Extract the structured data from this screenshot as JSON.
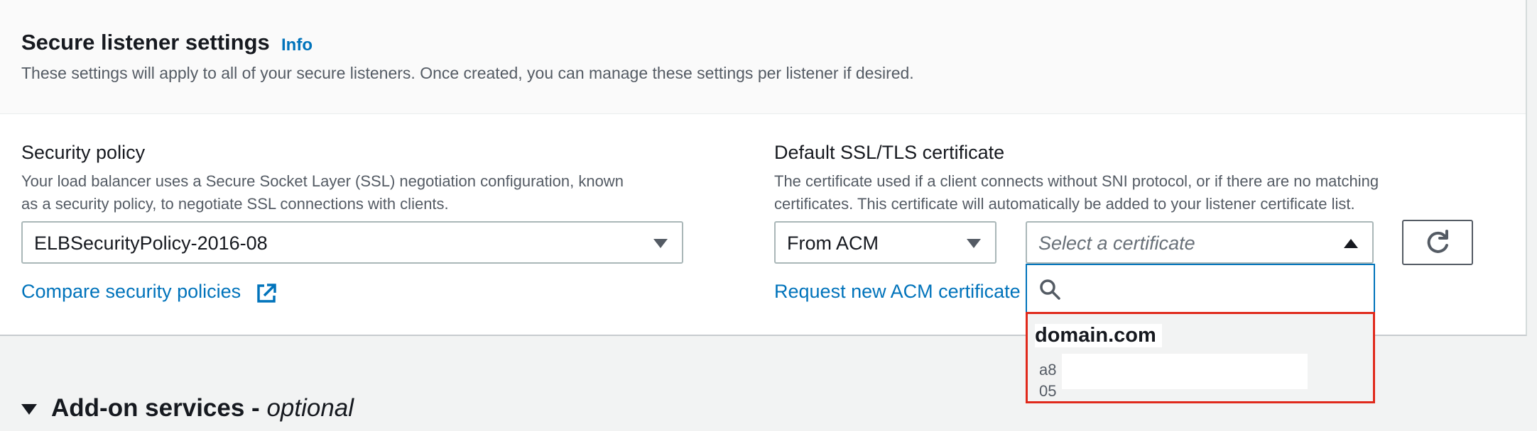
{
  "section": {
    "title": "Secure listener settings",
    "info_link": "Info",
    "description": "These settings will apply to all of your secure listeners. Once created, you can manage these settings per listener if desired."
  },
  "security_policy": {
    "label": "Security policy",
    "description_line1": "Your load balancer uses a Secure Socket Layer (SSL) negotiation configuration, known",
    "description_line2": "as a security policy, to negotiate SSL connections with clients.",
    "selected": "ELBSecurityPolicy-2016-08",
    "compare_link": "Compare security policies"
  },
  "certificate": {
    "label": "Default SSL/TLS certificate",
    "description_line1": "The certificate used if a client connects without SNI protocol, or if there are no matching",
    "description_line2": "certificates. This certificate will automatically be added to your listener certificate list.",
    "source_selected": "From ACM",
    "cert_placeholder": "Select a certificate",
    "request_link": "Request new ACM certificate",
    "search_placeholder": "",
    "options": [
      {
        "name": "domain.com",
        "id_line1": "a8",
        "id_line2": "05"
      }
    ]
  },
  "addon": {
    "title": "Add-on services -",
    "optional": "optional"
  },
  "colors": {
    "link": "#0073bb",
    "highlight_border": "#e0291b",
    "text_primary": "#16191f",
    "text_secondary": "#545b64"
  },
  "icons": [
    "external-link-icon",
    "caret-down-icon",
    "caret-up-icon",
    "refresh-icon",
    "search-icon",
    "expand-triangle-icon"
  ]
}
